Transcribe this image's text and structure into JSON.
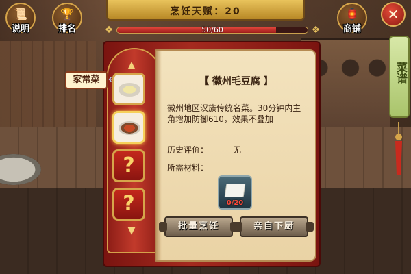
{
  "top_bar": {
    "title": "烹饪天赋：20",
    "progress_text": "50/60",
    "progress_fraction": 0.8333
  },
  "buttons": {
    "help_label": "说明",
    "rank_label": "排名",
    "shop_label": "商铺",
    "close_glyph": "✕"
  },
  "side_tab": {
    "label": "菜谱"
  },
  "category": {
    "label": "家常菜"
  },
  "recipe_slots": [
    {
      "state": "dish",
      "dish": "egg-custard"
    },
    {
      "state": "dish-selected",
      "dish": "maodou-fu"
    },
    {
      "state": "locked",
      "glyph": "?"
    },
    {
      "state": "locked",
      "glyph": "?"
    }
  ],
  "recipe": {
    "title": "【 徽州毛豆腐 】",
    "description": "徽州地区汉族传统名菜。30分钟内主角增加防御610，效果不叠加",
    "rating_label": "历史评价：",
    "rating_value": "无",
    "materials_label": "所需材料：",
    "material_count": "0/20"
  },
  "actions": {
    "batch_cook": "批量烹饪",
    "cook_yourself": "亲自下厨"
  },
  "colors": {
    "accent_gold": "#d6a54a",
    "book_red": "#a52a1f",
    "page_parchment": "#f3e3be",
    "progress_red": "#e0453a"
  }
}
